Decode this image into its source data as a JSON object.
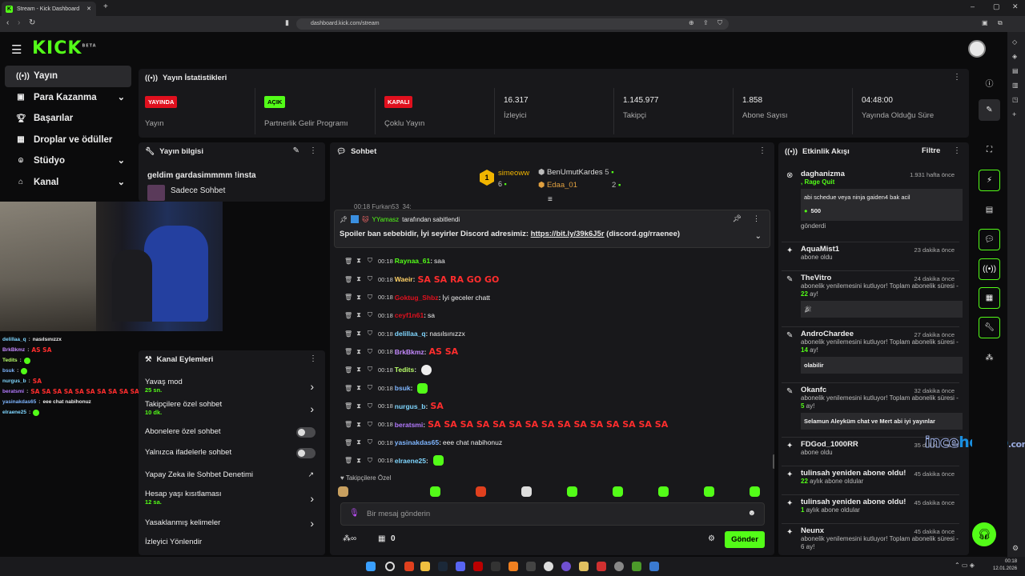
{
  "browser": {
    "tab_title": "Stream - Kick Dashboard",
    "url": "dashboard.kick.com/stream"
  },
  "logo": {
    "text": "KICK",
    "beta": "BETA"
  },
  "nav": {
    "items": [
      {
        "label": "Yayın",
        "icon": "broadcast-icon"
      },
      {
        "label": "Para Kazanma",
        "icon": "money-icon"
      },
      {
        "label": "Başarılar",
        "icon": "trophy-icon"
      },
      {
        "label": "Droplar ve ödüller",
        "icon": "gift-icon"
      },
      {
        "label": "Stüdyo",
        "icon": "studio-icon"
      },
      {
        "label": "Kanal",
        "icon": "channel-icon"
      }
    ]
  },
  "stats": {
    "title": "Yayın İstatistikleri",
    "items": [
      {
        "badge": "YAYINDA",
        "label": "Yayın"
      },
      {
        "badge": "AÇIK",
        "label": "Partnerlik Gelir Programı"
      },
      {
        "badge": "KAPALI",
        "label": "Çoklu Yayın"
      },
      {
        "value": "16.317",
        "label": "İzleyici"
      },
      {
        "value": "1.145.977",
        "label": "Takipçi"
      },
      {
        "value": "1.858",
        "label": "Abone Sayısı"
      },
      {
        "value": "04:48:00",
        "label": "Yayında Olduğu Süre"
      }
    ],
    "colors": {
      "live": "#e0101e",
      "on": "#53fc18",
      "off": "#e0101e"
    }
  },
  "stream_info": {
    "title": "Yayın bilgisi",
    "stream_title": "geldim gardasimmmm !insta",
    "category": "Sadece Sohbet"
  },
  "overlay_chat": [
    {
      "user": "delillaa_q",
      "msg": "nasılsınızzx",
      "color": "#7fd6ff"
    },
    {
      "user": "BrkBkmz",
      "msg": "AS SA",
      "color": "#c58aff"
    },
    {
      "user": "Tedits",
      "msg": "",
      "color": "#b9ff6a"
    },
    {
      "user": "bsuk",
      "msg": "",
      "color": "#7fb6ff"
    },
    {
      "user": "nurgus_b",
      "msg": "SA",
      "color": "#7fd6ff"
    },
    {
      "user": "beratsmi",
      "msg": "SA SA SA SA SA SA SA SA SA SA SA SA SA SA SA",
      "color": "#b37aff"
    },
    {
      "user": "yasinakdas65",
      "msg": "eee chat nabihonuz",
      "color": "#7fb6ff"
    },
    {
      "user": "elraene25",
      "msg": "",
      "color": "#7fd6ff"
    }
  ],
  "channel_actions": {
    "title": "Kanal Eylemleri",
    "items": [
      {
        "label": "Yavaş mod",
        "sub": "25 sn."
      },
      {
        "label": "Takipçilere özel sohbet",
        "sub": "10 dk."
      },
      {
        "label": "Abonelere özel sohbet"
      },
      {
        "label": "Yalnızca ifadelerle sohbet"
      },
      {
        "label": "Yapay Zeka ile Sohbet Denetimi"
      },
      {
        "label": "Hesap yaşı kısıtlaması",
        "sub": "12 sa."
      },
      {
        "label": "Yasaklanmış kelimeler"
      },
      {
        "label": "İzleyici Yönlendir"
      }
    ]
  },
  "chat": {
    "title": "Sohbet",
    "leaders": [
      {
        "rank": "1",
        "name": "simeoww",
        "count": "6"
      },
      {
        "name": "BenUmutKardes",
        "count": "5"
      },
      {
        "name": "Edaa_01",
        "count": "2"
      }
    ],
    "partial_row": "00:18 Furkan53_34:",
    "pinned": {
      "by_user": "YYamasz",
      "by_text": "tarafından sabitlendi",
      "message": "Spoiler ban sebebidir, İyi seyirler Discord adresimiz: ",
      "link": "https://bit.ly/39k6J5r",
      "after": " (discord.gg/rraenee)"
    },
    "messages": [
      {
        "time": "00:18",
        "user": "Raynaa_61",
        "color": "#53fc18",
        "text": "saa",
        "big": false
      },
      {
        "time": "00:18",
        "user": "Waeir",
        "color": "#ffd166",
        "text": "SA SA RA GO GO",
        "big": true
      },
      {
        "time": "00:18",
        "user": "Goktug_Shbz",
        "color": "#e0101e",
        "text": "İyi geceler chatt",
        "big": false
      },
      {
        "time": "00:18",
        "user": "ceyf1n61",
        "color": "#e0101e",
        "text": "sa",
        "big": false
      },
      {
        "time": "00:18",
        "user": "delillaa_q",
        "color": "#7fd6ff",
        "text": "nasılsınızzx",
        "big": false
      },
      {
        "time": "00:18",
        "user": "BrkBkmz",
        "color": "#c58aff",
        "text": "AS SA",
        "big": true
      },
      {
        "time": "00:18",
        "user": "Tedits",
        "color": "#b9ff6a",
        "text": "",
        "big": false
      },
      {
        "time": "00:18",
        "user": "bsuk",
        "color": "#7fb6ff",
        "text": "",
        "big": false
      },
      {
        "time": "00:18",
        "user": "nurgus_b",
        "color": "#7fd6ff",
        "text": "SA",
        "big": true
      },
      {
        "time": "00:18",
        "user": "beratsmi",
        "color": "#b37aff",
        "text": "SA SA SA SA SA SA SA SA SA SA SA SA SA SA SA",
        "big": true
      },
      {
        "time": "00:18",
        "user": "yasinakdas65",
        "color": "#7fb6ff",
        "text": "eee chat nabihonuz",
        "big": false
      },
      {
        "time": "00:18",
        "user": "elraene25",
        "color": "#7fd6ff",
        "text": "",
        "big": false
      }
    ],
    "followers_only": "Takipçilere Özel",
    "input_placeholder": "Bir mesaj gönderin",
    "send_label": "Gönder",
    "count": "0"
  },
  "activity": {
    "title": "Etkinlik Akışı",
    "filter": "Filtre",
    "items": [
      {
        "name": "daghanizma",
        "time": "1.931 hafta önce",
        "sub": ", Rage Quit",
        "box": "abi schedue veya ninja gaiden4 bak acil",
        "amount": "500",
        "after": "gönderdi"
      },
      {
        "name": "AquaMist1",
        "time": "23 dakika önce",
        "sub": "abone oldu"
      },
      {
        "name": "TheVitro",
        "time": "24 dakika önce",
        "sub": "abonelik yenilemesini kutluyor! Toplam abonelik süresi - ",
        "months": "22",
        "ay": " ay!"
      },
      {
        "name": "AndroChardee",
        "time": "27 dakika önce",
        "sub": "abonelik yenilemesini kutluyor! Toplam abonelik süresi - ",
        "months": "14",
        "ay": " ay!",
        "box": "olabilir"
      },
      {
        "name": "Okanfc",
        "time": "32 dakika önce",
        "sub": "abonelik yenilemesini kutluyor! Toplam abonelik süresi - ",
        "months": "5",
        "ay": " ay!",
        "box": "Selamun Aleyküm chat ve Mert abi iyi yayınlar"
      },
      {
        "name": "FDGod_1000RR",
        "time": "35 dakika önce",
        "sub": "abone oldu"
      },
      {
        "name": "tulinsah yeniden abone oldu!",
        "time": "45 dakika önce",
        "months": "22",
        "sub2": " aylık abone oldular"
      },
      {
        "name": "tulinsah yeniden abone oldu!",
        "time": "45 dakika önce",
        "months": "1",
        "sub2": " aylık abone oldular"
      },
      {
        "name": "Neunx",
        "time": "45 dakika önce",
        "sub": "abonelik yenilemesini kutluyor! Toplam abonelik süresi - 6 ay!"
      }
    ]
  },
  "watermark": {
    "a": "ince",
    "b": "hesap",
    "c": ".com"
  },
  "clock": {
    "time": "00:18",
    "date": "12.01.2026"
  }
}
